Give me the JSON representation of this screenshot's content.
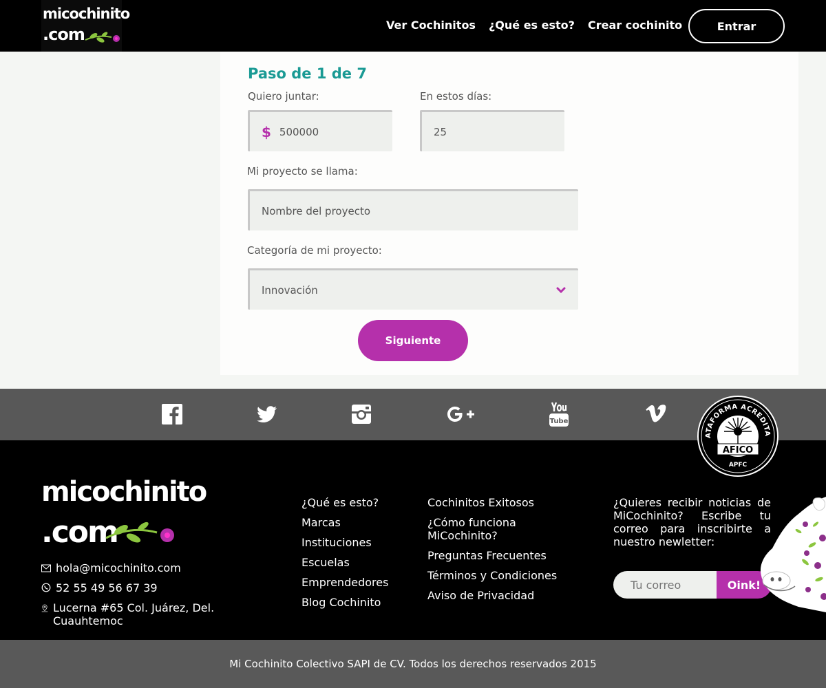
{
  "header": {
    "logo_line1": "micochinito",
    "logo_line2": ".com",
    "nav": [
      "Ver Cochinitos",
      "¿Qué es esto?",
      "Crear cochinito"
    ],
    "login": "Entrar"
  },
  "form": {
    "step_title": "Paso de 1 de 7",
    "amount_label": "Quiero juntar:",
    "currency_symbol": "$",
    "amount_value": "500000",
    "days_label": "En estos días:",
    "days_value": "25",
    "name_label": "Mi proyecto se llama:",
    "name_placeholder": "Nombre del proyecto",
    "category_label": "Categoría de mi proyecto:",
    "category_value": "Innovación",
    "next_button": "Siguiente"
  },
  "social_icons": [
    "facebook-icon",
    "twitter-icon",
    "instagram-icon",
    "google-plus-icon",
    "youtube-icon",
    "vimeo-icon"
  ],
  "badge": {
    "top_text": "PLATAFORMA ACREDITADA",
    "center_text": "AFICO",
    "bottom_text": "APFC"
  },
  "footer": {
    "logo_line1": "micochinito",
    "logo_line2": ".com",
    "email": "hola@micochinito.com",
    "phone": "52 55 49 56 67 39",
    "address": "Lucerna #65 Col. Juárez, Del. Cuauhtemoc",
    "links_col1": [
      "¿Qué es esto?",
      "Marcas",
      "Instituciones",
      "Escuelas",
      "Emprendedores",
      "Blog Cochinito"
    ],
    "links_col2": [
      "Cochinitos Exitosos",
      "¿Cómo funciona MiCochinito?",
      "Preguntas Frecuentes",
      "Términos y Condiciones",
      "Aviso de Privacidad"
    ],
    "newsletter_text": "¿Quieres recibir noticias de MiCochinito? Escribe tu correo para inscribirte a nuestro newletter:",
    "email_placeholder": "Tu correo",
    "subscribe_button": "Oink!"
  },
  "copyright": "Mi Cochinito Colectivo SAPI de CV. Todos los derechos reservados 2015",
  "colors": {
    "accent": "#b530ab",
    "title": "#1a9a94",
    "header_bg": "#000000",
    "social_bg": "#585858"
  }
}
